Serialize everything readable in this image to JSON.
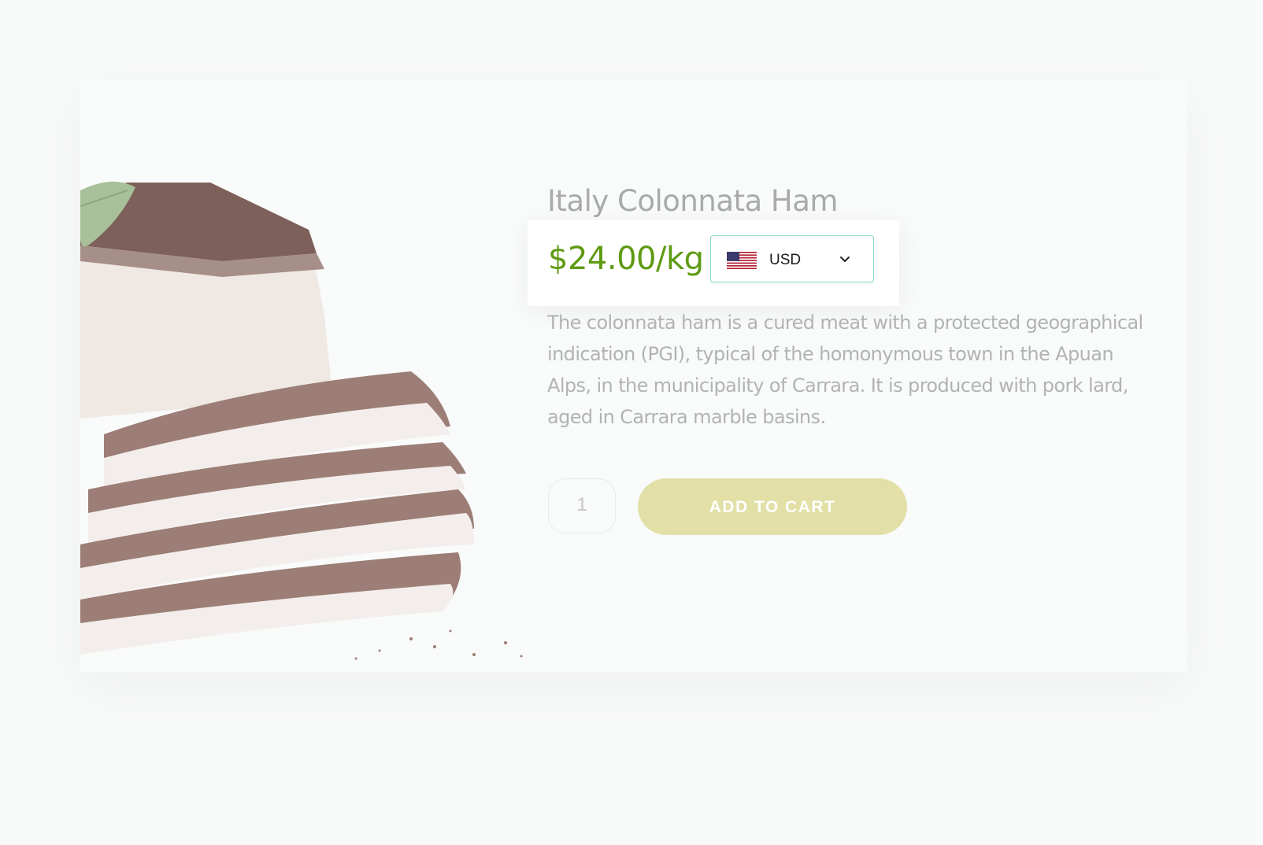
{
  "product": {
    "title": "Italy Colonnata Ham",
    "price": "$24.00/kg",
    "description": "The colonnata ham is a cured meat with a protected geographical indication (PGI), typical of the homonymous town in the Apuan Alps, in the municipality of Carrara. It is produced with pork lard, aged in Carrara marble basins.",
    "image_icon": "cured-ham-image"
  },
  "currency": {
    "selected": "USD",
    "flag_icon": "us-flag-icon",
    "dropdown_icon": "chevron-down-icon",
    "border_color": "#8ed9cf"
  },
  "cart": {
    "quantity": "1",
    "add_label": "ADD TO CART",
    "button_color": "#e2e0a7"
  },
  "colors": {
    "price": "#5e9a12",
    "title": "#a9aaaa",
    "description": "#b2b3b3"
  }
}
